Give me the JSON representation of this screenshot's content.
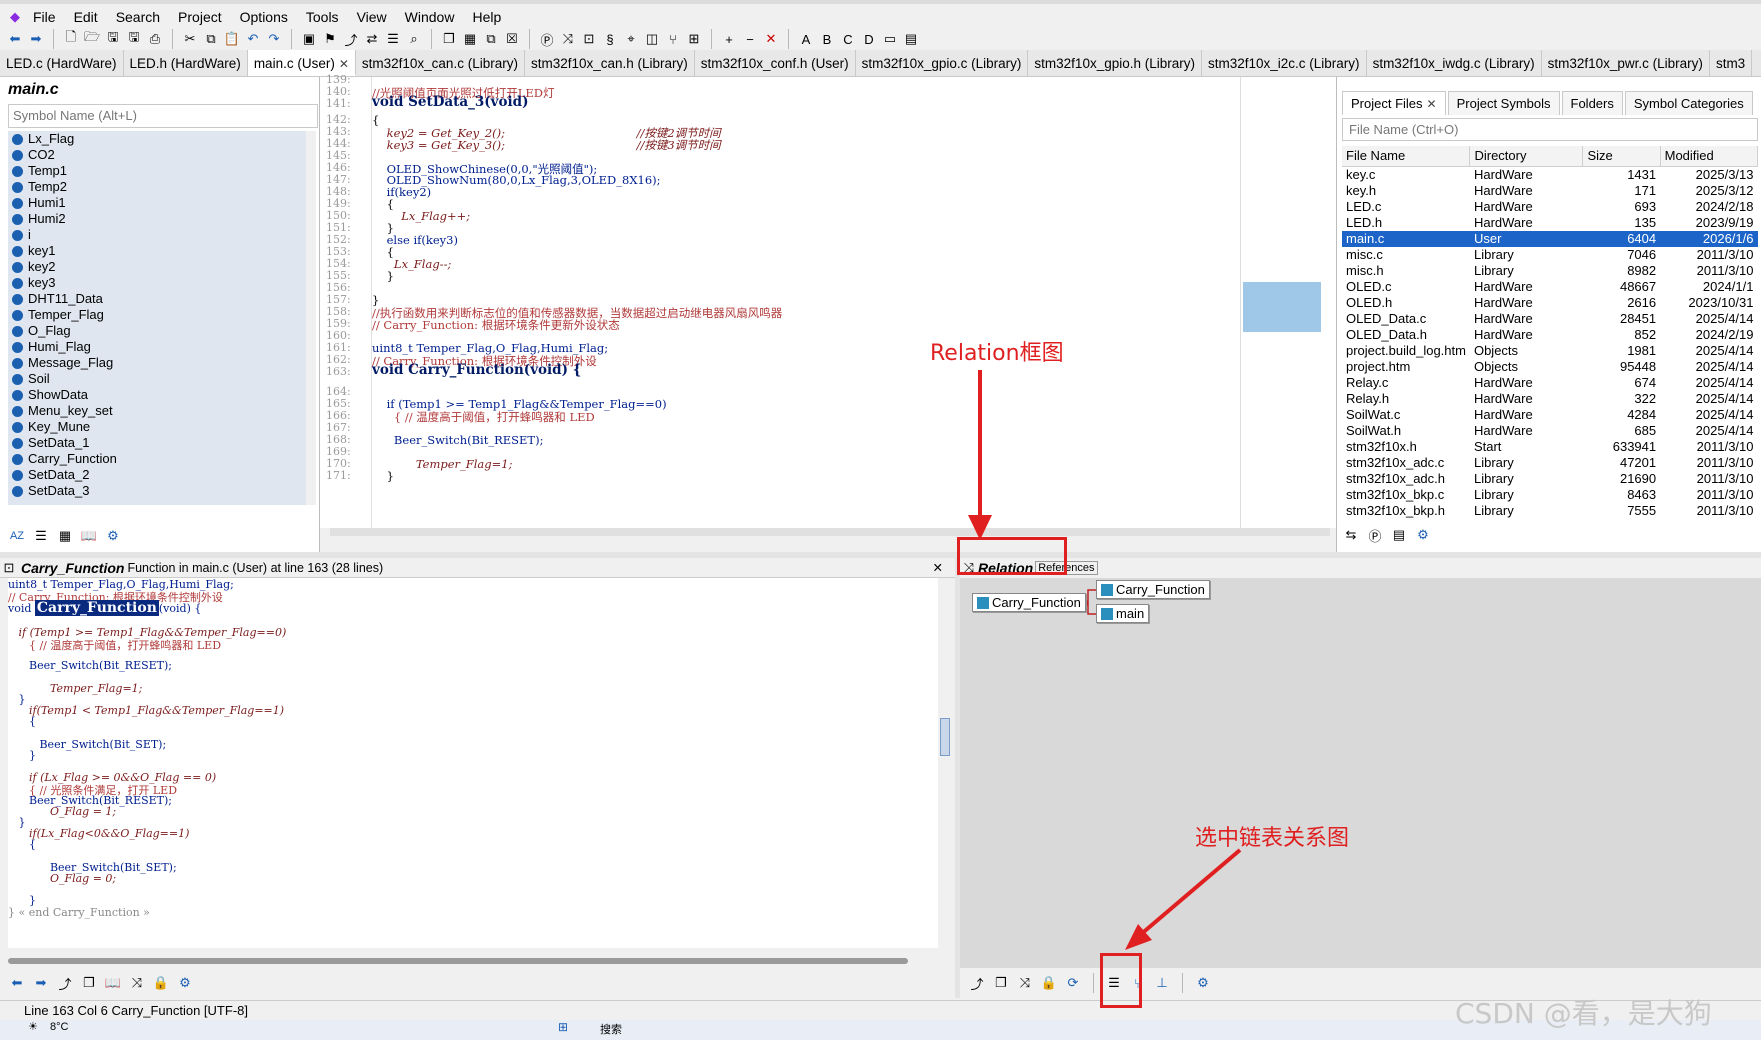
{
  "menu": [
    "File",
    "Edit",
    "Search",
    "Project",
    "Options",
    "Tools",
    "View",
    "Window",
    "Help"
  ],
  "file_tabs": [
    {
      "label": "LED.c (HardWare)",
      "active": false
    },
    {
      "label": "LED.h (HardWare)",
      "active": false
    },
    {
      "label": "main.c (User)",
      "active": true
    },
    {
      "label": "stm32f10x_can.c (Library)",
      "active": false
    },
    {
      "label": "stm32f10x_can.h (Library)",
      "active": false
    },
    {
      "label": "stm32f10x_conf.h (User)",
      "active": false
    },
    {
      "label": "stm32f10x_gpio.c (Library)",
      "active": false
    },
    {
      "label": "stm32f10x_gpio.h (Library)",
      "active": false
    },
    {
      "label": "stm32f10x_i2c.c (Library)",
      "active": false
    },
    {
      "label": "stm32f10x_iwdg.c (Library)",
      "active": false
    },
    {
      "label": "stm32f10x_pwr.c (Library)",
      "active": false
    },
    {
      "label": "stm3",
      "active": false
    }
  ],
  "symbol_panel": {
    "title": "main.c",
    "search_placeholder": "Symbol Name (Alt+L)",
    "items": [
      "Lx_Flag",
      "CO2",
      "Temp1",
      "Temp2",
      "Humi1",
      "Humi2",
      "i",
      "key1",
      "key2",
      "key3",
      "DHT11_Data",
      "Temper_Flag",
      "O_Flag",
      "Humi_Flag",
      "Message_Flag",
      "Soil",
      "ShowData",
      "Menu_key_set",
      "Key_Mune",
      "SetData_1",
      "Carry_Function",
      "SetData_2",
      "SetData_3"
    ]
  },
  "editor_lines": [
    {
      "n": "139:",
      "t": ""
    },
    {
      "n": "140:",
      "t": "//光照阈值页面光照过低打开LED灯",
      "c": "cmt"
    },
    {
      "n": "141:",
      "t": "void SetData_3(void)",
      "c": "fnline"
    },
    {
      "n": "142:",
      "t": "{"
    },
    {
      "n": "143:",
      "t": "    key2 = Get_Key_2();                                    //按键2调节时间",
      "c": "it"
    },
    {
      "n": "144:",
      "t": "    key3 = Get_Key_3();                                    //按键3调节时间",
      "c": "it"
    },
    {
      "n": "145:",
      "t": ""
    },
    {
      "n": "146:",
      "t": "    OLED_ShowChinese(0,0,\"光照阈值\");",
      "c": "kw"
    },
    {
      "n": "147:",
      "t": "    OLED_ShowNum(80,0,Lx_Flag,3,OLED_8X16);",
      "c": "kw"
    },
    {
      "n": "148:",
      "t": "    if(key2)",
      "c": "kw"
    },
    {
      "n": "149:",
      "t": "    {"
    },
    {
      "n": "150:",
      "t": "        Lx_Flag++;",
      "c": "it"
    },
    {
      "n": "151:",
      "t": "    }"
    },
    {
      "n": "152:",
      "t": "    else if(key3)",
      "c": "kw"
    },
    {
      "n": "153:",
      "t": "    {"
    },
    {
      "n": "154:",
      "t": "      Lx_Flag--;",
      "c": "it"
    },
    {
      "n": "155:",
      "t": "    }"
    },
    {
      "n": "156:",
      "t": ""
    },
    {
      "n": "157:",
      "t": "}"
    },
    {
      "n": "158:",
      "t": "//执行函数用来判断标志位的值和传感器数据，当数据超过启动继电器风扇风鸣器",
      "c": "cmt"
    },
    {
      "n": "159:",
      "t": "// Carry_Function: 根据环境条件更新外设状态",
      "c": "cmt"
    },
    {
      "n": "160:",
      "t": ""
    },
    {
      "n": "161:",
      "t": "uint8_t Temper_Flag,O_Flag,Humi_Flag;",
      "c": "kw"
    },
    {
      "n": "162:",
      "t": "// Carry_Function: 根据环境条件控制外设",
      "c": "cmt"
    },
    {
      "n": "163:",
      "t": "void Carry_Function(void) {",
      "c": "fnline"
    },
    {
      "n": "164:",
      "t": ""
    },
    {
      "n": "165:",
      "t": "    if (Temp1 >= Temp1_Flag&&Temper_Flag==0)",
      "c": "kw"
    },
    {
      "n": "166:",
      "t": "      { // 温度高于阈值，打开蜂鸣器和 LED",
      "c": "cmt"
    },
    {
      "n": "167:",
      "t": ""
    },
    {
      "n": "168:",
      "t": "      Beer_Switch(Bit_RESET);",
      "c": "kw"
    },
    {
      "n": "169:",
      "t": ""
    },
    {
      "n": "170:",
      "t": "            Temper_Flag=1;",
      "c": "it"
    },
    {
      "n": "171:",
      "t": "    }"
    }
  ],
  "file_panel": {
    "tabs": [
      "Project Files",
      "Project Symbols",
      "Folders",
      "Symbol Categories"
    ],
    "search_placeholder": "File Name (Ctrl+O)",
    "columns": [
      "File Name",
      "Directory",
      "Size",
      "Modified"
    ],
    "rows": [
      [
        "key.c",
        "HardWare",
        "1431",
        "2025/3/13"
      ],
      [
        "key.h",
        "HardWare",
        "171",
        "2025/3/12"
      ],
      [
        "LED.c",
        "HardWare",
        "693",
        "2024/2/18"
      ],
      [
        "LED.h",
        "HardWare",
        "135",
        "2023/9/19"
      ],
      [
        "main.c",
        "User",
        "6404",
        "2026/1/6"
      ],
      [
        "misc.c",
        "Library",
        "7046",
        "2011/3/10"
      ],
      [
        "misc.h",
        "Library",
        "8982",
        "2011/3/10"
      ],
      [
        "OLED.c",
        "HardWare",
        "48667",
        "2024/1/1"
      ],
      [
        "OLED.h",
        "HardWare",
        "2616",
        "2023/10/31"
      ],
      [
        "OLED_Data.c",
        "HardWare",
        "28451",
        "2025/4/14"
      ],
      [
        "OLED_Data.h",
        "HardWare",
        "852",
        "2024/2/19"
      ],
      [
        "project.build_log.htm",
        "Objects",
        "1981",
        "2025/4/14"
      ],
      [
        "project.htm",
        "Objects",
        "95448",
        "2025/4/14"
      ],
      [
        "Relay.c",
        "HardWare",
        "674",
        "2025/4/14"
      ],
      [
        "Relay.h",
        "HardWare",
        "322",
        "2025/4/14"
      ],
      [
        "SoilWat.c",
        "HardWare",
        "4284",
        "2025/4/14"
      ],
      [
        "SoilWat.h",
        "HardWare",
        "685",
        "2025/4/14"
      ],
      [
        "stm32f10x.h",
        "Start",
        "633941",
        "2011/3/10"
      ],
      [
        "stm32f10x_adc.c",
        "Library",
        "47201",
        "2011/3/10"
      ],
      [
        "stm32f10x_adc.h",
        "Library",
        "21690",
        "2011/3/10"
      ],
      [
        "stm32f10x_bkp.c",
        "Library",
        "8463",
        "2011/3/10"
      ],
      [
        "stm32f10x_bkp.h",
        "Library",
        "7555",
        "2011/3/10"
      ]
    ],
    "selected_index": 4
  },
  "context": {
    "title": "Carry_Function",
    "subtitle": "Function in main.c (User) at line 163 (28 lines)",
    "lines": [
      "uint8_t Temper_Flag,O_Flag,Humi_Flag;",
      "// Carry_Function: 根据环境条件控制外设",
      "void Carry_Function(void) {",
      "",
      "   if (Temp1 >= Temp1_Flag&&Temper_Flag==0)",
      "      { // 温度高于阈值，打开蜂鸣器和 LED",
      "",
      "      Beer_Switch(Bit_RESET);",
      "",
      "            Temper_Flag=1;",
      "   }",
      "      if(Temp1 < Temp1_Flag&&Temper_Flag==1)",
      "      {",
      "",
      "         Beer_Switch(Bit_SET);",
      "      }",
      "",
      "      if (Lx_Flag >= 0&&O_Flag == 0)",
      "      { // 光照条件满足，打开 LED",
      "      Beer_Switch(Bit_RESET);",
      "            O_Flag = 1;",
      "   }",
      "      if(Lx_Flag<0&&O_Flag==1)",
      "      {",
      "",
      "            Beer_Switch(Bit_SET);",
      "            O_Flag = 0;",
      "",
      "      }",
      "} « end Carry_Function »"
    ]
  },
  "relation": {
    "title": "Relation",
    "tab_suffix": "References",
    "nodes": {
      "center": "Carry_Function",
      "caller1": "Carry_Function",
      "caller2": "main"
    }
  },
  "status_bar": "Line 163  Col 6   Carry_Function  [UTF-8]",
  "taskbar": {
    "weather": "8°C",
    "search": "搜索"
  },
  "annotations": {
    "relation_label": "Relation框图",
    "select_label": "选中链表关系图",
    "color": "#e02020"
  },
  "watermark": "CSDN @看，是大狗"
}
